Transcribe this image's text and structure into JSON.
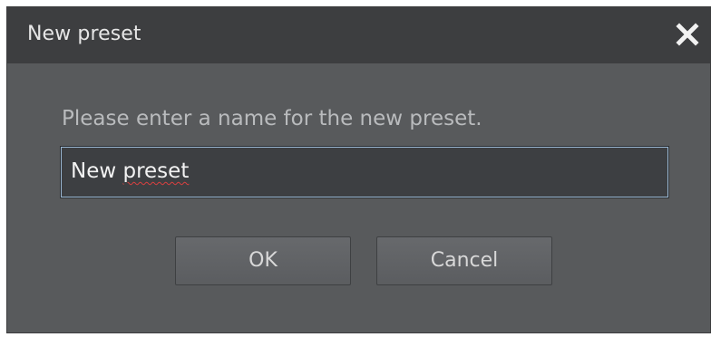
{
  "dialog": {
    "title": "New preset",
    "close_icon": "close-icon",
    "prompt": "Please enter a name for the new preset.",
    "name_input": {
      "value_word1": "New",
      "value_word2": "preset",
      "misspelled_word": "preset"
    },
    "buttons": {
      "ok_label": "OK",
      "cancel_label": "Cancel"
    }
  },
  "colors": {
    "titlebar": "#3d3e40",
    "body": "#585a5c",
    "field_border": "#9ab8d4",
    "spellcheck_underline": "#d94040"
  }
}
